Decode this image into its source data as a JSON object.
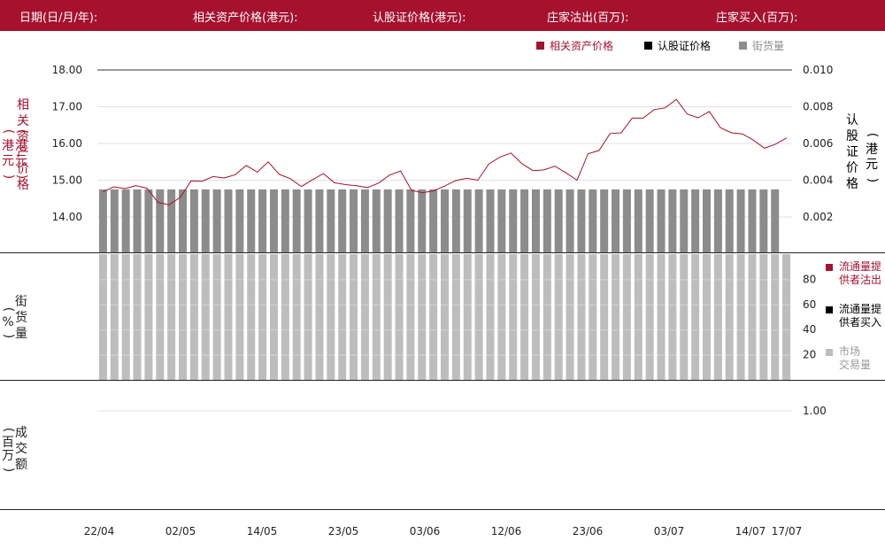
{
  "header": {
    "date_label": "日期(日/月/年):",
    "asset_price_label": "相关资产价格(港元):",
    "warrant_price_label": "认股证价格(港元):",
    "dealer_sell_label": "庄家沽出(百万):",
    "dealer_buy_label": "庄家买入(百万):"
  },
  "legend": {
    "asset_price": "相关资产价格",
    "warrant_price": "认股证价格",
    "street_holding": "街货量"
  },
  "axis_titles": {
    "left_top": [
      "相",
      "关",
      "资",
      "产",
      "价",
      "格"
    ],
    "left_top_unit": [
      "(",
      "港",
      "元",
      ")"
    ],
    "right_top": [
      "认",
      "股",
      "证",
      "价",
      "格"
    ],
    "right_top_unit": [
      "(",
      "港",
      "元",
      ")"
    ],
    "left_mid": [
      "街",
      "货",
      "量"
    ],
    "left_mid_unit": [
      "(",
      "%",
      ")"
    ],
    "left_bottom": [
      "成",
      "交",
      "额"
    ],
    "left_bottom_unit": [
      "(",
      "百",
      "万",
      ")"
    ]
  },
  "side_legend": {
    "lp_sell_1": "流通量提",
    "lp_sell_2": "供者沽出",
    "lp_buy_1": "流通量提",
    "lp_buy_2": "供者买入",
    "market_1": "市场",
    "market_2": "交易量"
  },
  "colors": {
    "brand": "#a6112e",
    "asset_line": "#a6112e",
    "warrant": "#000000",
    "street_bar": "#8c8c8c",
    "street_bar_light": "#bdbdbd",
    "market_bar": "#bdbdbd"
  },
  "chart_data": [
    {
      "type": "line",
      "x_ticks": [
        "22/04",
        "02/05",
        "14/05",
        "23/05",
        "03/06",
        "12/06",
        "23/06",
        "03/07",
        "14/07",
        "17/07"
      ],
      "y_left_ticks": [
        "18.00",
        "17.00",
        "16.00",
        "15.00",
        "14.00"
      ],
      "y_left_range": [
        13.0,
        18.0
      ],
      "y_right_ticks": [
        "0.010",
        "0.008",
        "0.006",
        "0.004",
        "0.002"
      ],
      "y_right_range": [
        0,
        0.01
      ],
      "series": [
        {
          "name": "相关资产价格",
          "axis": "left",
          "values": [
            14.68,
            14.82,
            14.77,
            14.85,
            14.78,
            14.4,
            14.33,
            14.53,
            14.98,
            14.97,
            15.1,
            15.06,
            15.15,
            15.4,
            15.22,
            15.5,
            15.16,
            15.04,
            14.83,
            15.01,
            15.18,
            14.93,
            14.88,
            14.85,
            14.8,
            14.92,
            15.14,
            15.25,
            14.72,
            14.66,
            14.71,
            14.84,
            14.99,
            15.05,
            15.0,
            15.44,
            15.63,
            15.74,
            15.45,
            15.26,
            15.28,
            15.38,
            15.2,
            15.0,
            15.72,
            15.81,
            16.27,
            16.29,
            16.69,
            16.69,
            16.92,
            16.97,
            17.2,
            16.8,
            16.7,
            16.87,
            16.43,
            16.29,
            16.26,
            16.09,
            15.87,
            15.98,
            16.15
          ]
        },
        {
          "name": "认股证价格",
          "axis": "right",
          "values": []
        },
        {
          "name": "街货量",
          "axis": "left",
          "type": "bar",
          "values": [
            14.75,
            14.75,
            14.75,
            14.75,
            14.75,
            14.75,
            14.75,
            14.75,
            14.75,
            14.75,
            14.75,
            14.75,
            14.75,
            14.75,
            14.75,
            14.75,
            14.75,
            14.75,
            14.75,
            14.75,
            14.75,
            14.75,
            14.75,
            14.75,
            14.75,
            14.75,
            14.75,
            14.75,
            14.75,
            14.75,
            14.75,
            14.75,
            14.75,
            14.75,
            14.75,
            14.75,
            14.75,
            14.75,
            14.75,
            14.75,
            14.75,
            14.75,
            14.75,
            14.75,
            14.75,
            14.75,
            14.75,
            14.75,
            14.75,
            14.75,
            14.75,
            14.75,
            14.75,
            14.75,
            14.75,
            14.75,
            14.75,
            14.75,
            14.75,
            14.75
          ]
        }
      ]
    },
    {
      "type": "bar",
      "y_right_ticks": [
        "80",
        "60",
        "40",
        "20"
      ],
      "y_range": [
        0,
        100
      ],
      "series": [
        {
          "name": "街货量",
          "values": [
            100,
            100,
            100,
            100,
            100,
            100,
            100,
            100,
            100,
            100,
            100,
            100,
            100,
            100,
            100,
            100,
            100,
            100,
            100,
            100,
            100,
            100,
            100,
            100,
            100,
            100,
            100,
            100,
            100,
            100,
            100,
            100,
            100,
            100,
            100,
            100,
            100,
            100,
            100,
            100,
            100,
            100,
            100,
            100,
            100,
            100,
            100,
            100,
            100,
            100,
            100,
            100,
            100,
            100,
            100,
            100,
            100,
            100,
            100,
            100,
            100
          ]
        }
      ]
    },
    {
      "type": "bar",
      "y_right_ticks": [
        "1.00"
      ],
      "y_range": [
        0,
        1.25
      ],
      "series": [
        {
          "name": "流通量提供者沽出",
          "values": []
        },
        {
          "name": "流通量提供者买入",
          "values": []
        },
        {
          "name": "市场交易量",
          "values": []
        }
      ]
    }
  ]
}
